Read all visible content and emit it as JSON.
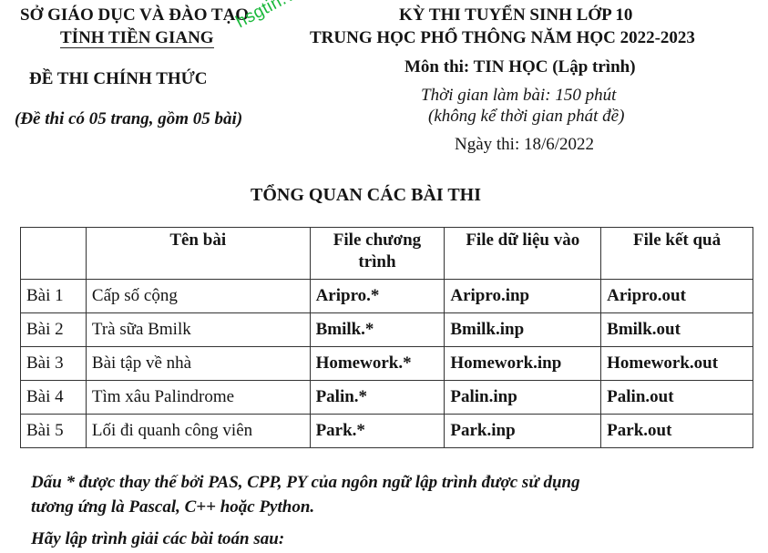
{
  "header_left": {
    "department": "SỞ GIÁO DỤC VÀ ĐÀO TẠO",
    "province": "TỈNH TIỀN GIANG",
    "official": "ĐỀ THI CHÍNH THỨC",
    "pages_note": "(Đề thi có 05 trang, gồm 05 bài)"
  },
  "watermark": "hsgtin.vn",
  "header_right": {
    "exam_title": "KỲ THI TUYỂN SINH LỚP 10",
    "exam_subtitle": "TRUNG HỌC PHỔ THÔNG NĂM HỌC 2022-2023",
    "subject": "Môn thi: TIN HỌC (Lập trình)",
    "duration": "Thời gian làm bài: 150 phút",
    "duration_note": "(không kể thời gian phát đề)",
    "exam_date": "Ngày thi: 18/6/2022"
  },
  "overview": {
    "heading": "TỔNG QUAN CÁC BÀI THI",
    "columns": [
      "",
      "Tên bài",
      "File chương trình",
      "File dữ liệu vào",
      "File kết quả"
    ],
    "rows": [
      [
        "Bài 1",
        "Cấp số cộng",
        "Aripro.*",
        "Aripro.inp",
        "Aripro.out"
      ],
      [
        "Bài 2",
        "Trà sữa Bmilk",
        "Bmilk.*",
        "Bmilk.inp",
        "Bmilk.out"
      ],
      [
        "Bài 3",
        "Bài tập về nhà",
        "Homework.*",
        "Homework.inp",
        "Homework.out"
      ],
      [
        "Bài 4",
        "Tìm xâu Palindrome",
        "Palin.*",
        "Palin.inp",
        "Palin.out"
      ],
      [
        "Bài 5",
        "Lối đi quanh công viên",
        "Park.*",
        "Park.inp",
        "Park.out"
      ]
    ]
  },
  "notes": {
    "line1": "Dấu * được thay thế bởi PAS, CPP, PY của ngôn ngữ lập trình được sử dụng",
    "line2": "tương ứng là Pascal, C++ hoặc Python.",
    "instruction": "Hãy lập trình giải các bài toán sau:"
  }
}
